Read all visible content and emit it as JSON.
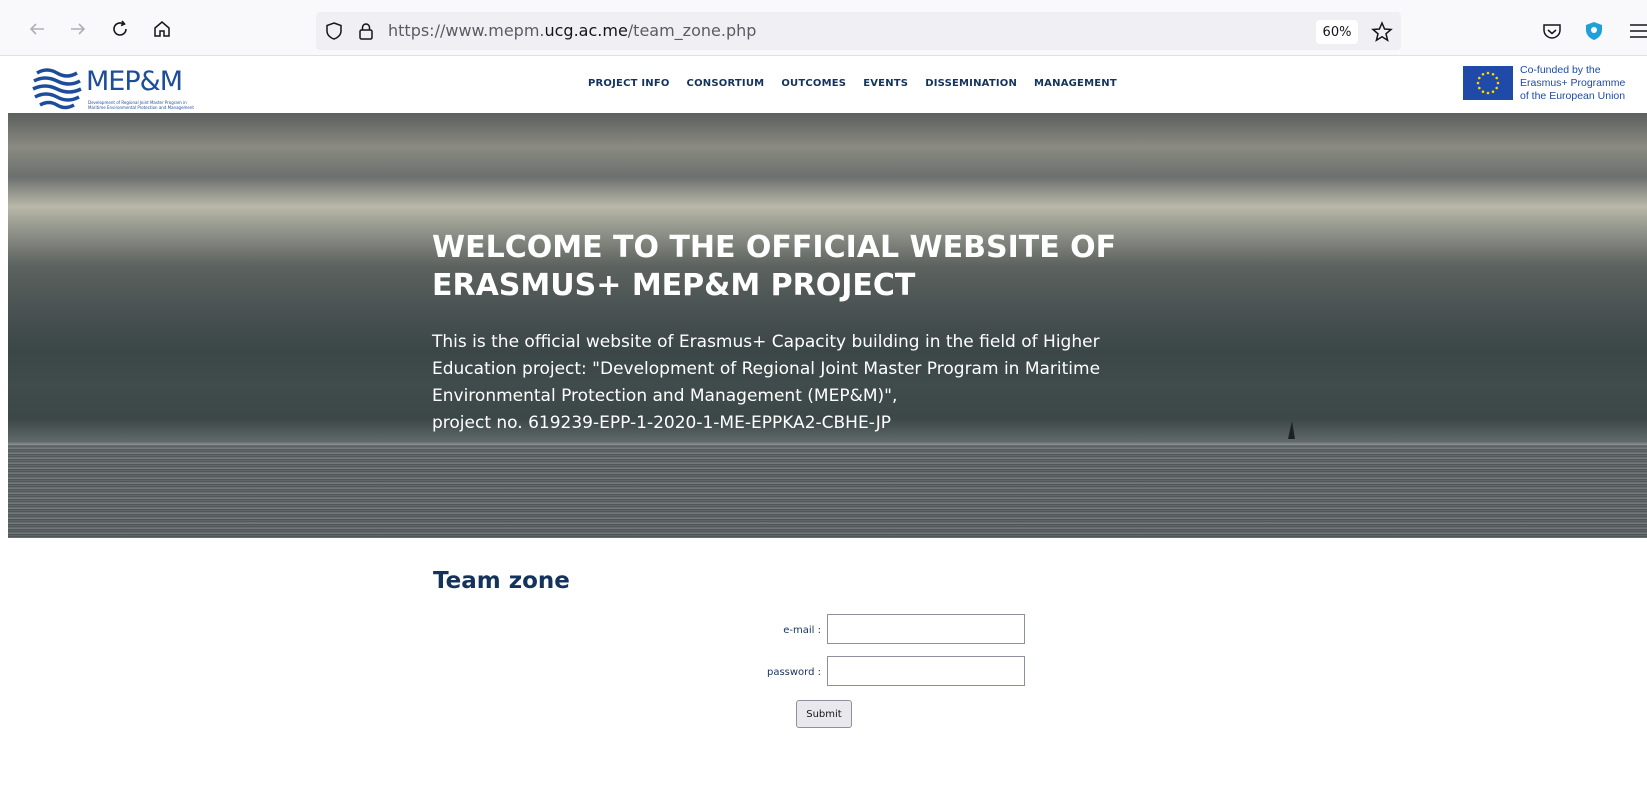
{
  "browser": {
    "url_prefix": "https://www.mepm.",
    "url_domain": "ucg.ac.me",
    "url_path": "/team_zone.php",
    "zoom": "60%",
    "icons": [
      "back-arrow-icon",
      "forward-arrow-icon",
      "reload-icon",
      "home-icon",
      "shield-icon",
      "lock-icon",
      "bookmark-star-icon",
      "pocket-icon",
      "extension-shield-icon",
      "menu-icon"
    ]
  },
  "header": {
    "logo_text": "MEP&M",
    "logo_subtitle": "Development of Regional Joint Master Program in Maritime Environmental Protection and Management",
    "nav": [
      "PROJECT INFO",
      "CONSORTIUM",
      "OUTCOMES",
      "EVENTS",
      "DISSEMINATION",
      "MANAGEMENT"
    ],
    "eu_text_line1": "Co-funded by the",
    "eu_text_line2": "Erasmus+ Programme",
    "eu_text_line3": "of the European Union"
  },
  "hero": {
    "title_line1": "WELCOME TO THE OFFICIAL WEBSITE OF",
    "title_line2": "ERASMUS+ MEP&M PROJECT",
    "text_line1": "This is the official website of Erasmus+ Capacity building in the field of Higher",
    "text_line2": "Education project: \"Development of Regional Joint Master Program in Maritime",
    "text_line3": "Environmental Protection and Management (MEP&M)\",",
    "text_line4": "project no. 619239-EPP-1-2020-1-ME-EPPKA2-CBHE-JP"
  },
  "team_zone": {
    "title": "Team zone",
    "email_label": "e-mail :",
    "email_value": "",
    "password_label": "password :",
    "password_value": "",
    "submit_label": "Submit"
  },
  "colors": {
    "brand_blue": "#14335c",
    "logo_blue": "#1d4d9a",
    "eu_blue": "#1f4aa8"
  }
}
